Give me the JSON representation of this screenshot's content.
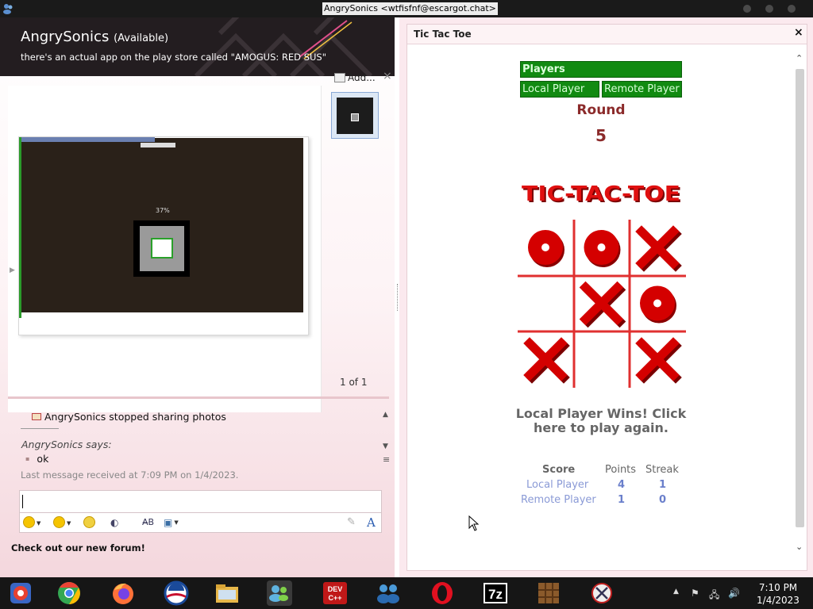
{
  "window": {
    "title": "AngrySonics <wtfisfnf@escargot.chat>"
  },
  "contact": {
    "name": "AngrySonics",
    "status": "(Available)",
    "personal_message": "there's an actual app on the play store called \"AMOGUS: RED SUS\""
  },
  "photo_share": {
    "add_label": "Add...",
    "close_label": "×",
    "pager": "1 of 1",
    "preview_percent": "37%"
  },
  "conversation": {
    "system_message": "AngrySonics stopped sharing photos",
    "sender_says": "AngrySonics says:",
    "message": "ok",
    "last_received": "Last message received at 7:09 PM on 1/4/2023."
  },
  "input": {
    "value": ""
  },
  "toolbar": {
    "font_label": "A"
  },
  "footer": {
    "forum_link": "Check out our new forum!"
  },
  "game": {
    "window_title": "Tic Tac Toe",
    "close_label": "×",
    "players_header": "Players",
    "local_player": "Local Player",
    "remote_player": "Remote Player",
    "round_label": "Round",
    "round_number": "5",
    "logo_text": "TIC-TAC-TOE",
    "board": [
      "O",
      "O",
      "X",
      "",
      "X",
      "O",
      "X",
      "",
      "X"
    ],
    "result_line1": "Local Player Wins! Click",
    "result_line2": "here to play again.",
    "score": {
      "col_score": "Score",
      "col_points": "Points",
      "col_streak": "Streak",
      "rows": [
        {
          "name": "Local Player",
          "points": "4",
          "streak": "1"
        },
        {
          "name": "Remote Player",
          "points": "1",
          "streak": "0"
        }
      ]
    },
    "colors": {
      "green": "#118a11",
      "round": "#8b2a2a",
      "mark_red": "#d40000"
    }
  },
  "taskbar": {
    "apps": [
      "chrome-os-icon",
      "chrome-icon",
      "firefox-icon",
      "obama-icon",
      "file-explorer-icon",
      "messenger-icon",
      "devcpp-icon",
      "msn-users-icon",
      "opera-icon",
      "7zip-icon",
      "minecraft-icon",
      "snipping-tool-icon"
    ],
    "clock_time": "7:10 PM",
    "clock_date": "1/4/2023",
    "devcpp_label": "DEV C++",
    "sevenzip_label": "7z"
  }
}
